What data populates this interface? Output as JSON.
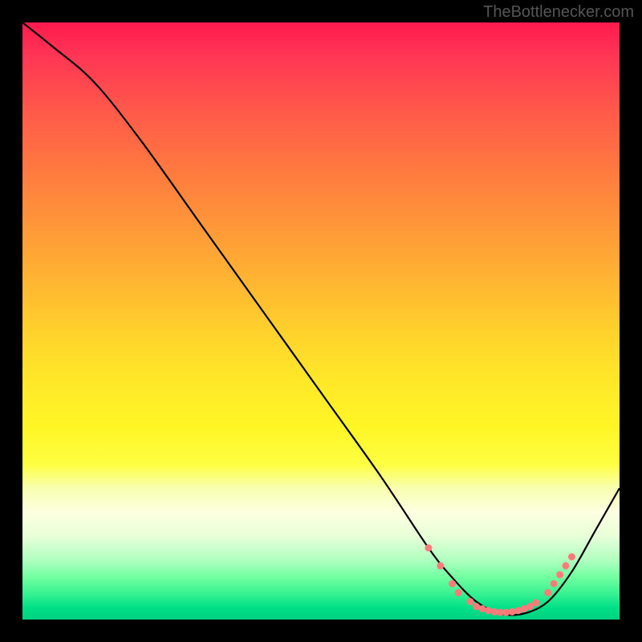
{
  "watermark": "TheBottlenecker.com",
  "chart_data": {
    "type": "line",
    "title": "",
    "xlabel": "",
    "ylabel": "",
    "xlim": [
      0,
      100
    ],
    "ylim": [
      0,
      100
    ],
    "series": [
      {
        "name": "curve",
        "x": [
          0,
          5,
          12,
          20,
          30,
          40,
          50,
          60,
          68,
          72,
          76,
          80,
          84,
          88,
          92,
          96,
          100
        ],
        "y": [
          100,
          96,
          90,
          80,
          66,
          52,
          38,
          24,
          12,
          7,
          3,
          1,
          1,
          3,
          8,
          15,
          22
        ]
      }
    ],
    "markers": {
      "comment": "coral dotted markers along the valley region",
      "points": [
        {
          "x": 68,
          "y": 12
        },
        {
          "x": 70,
          "y": 9
        },
        {
          "x": 72,
          "y": 6
        },
        {
          "x": 73,
          "y": 4.5
        },
        {
          "x": 75,
          "y": 3
        },
        {
          "x": 76,
          "y": 2.2
        },
        {
          "x": 77,
          "y": 1.8
        },
        {
          "x": 78,
          "y": 1.5
        },
        {
          "x": 79,
          "y": 1.3
        },
        {
          "x": 80,
          "y": 1.2
        },
        {
          "x": 81,
          "y": 1.2
        },
        {
          "x": 82,
          "y": 1.3
        },
        {
          "x": 83,
          "y": 1.5
        },
        {
          "x": 84,
          "y": 1.8
        },
        {
          "x": 85,
          "y": 2.2
        },
        {
          "x": 86,
          "y": 2.8
        },
        {
          "x": 88,
          "y": 4.5
        },
        {
          "x": 89,
          "y": 6
        },
        {
          "x": 90,
          "y": 7.5
        },
        {
          "x": 91,
          "y": 9
        },
        {
          "x": 92,
          "y": 10.5
        }
      ],
      "color": "#ff7a7a"
    }
  }
}
